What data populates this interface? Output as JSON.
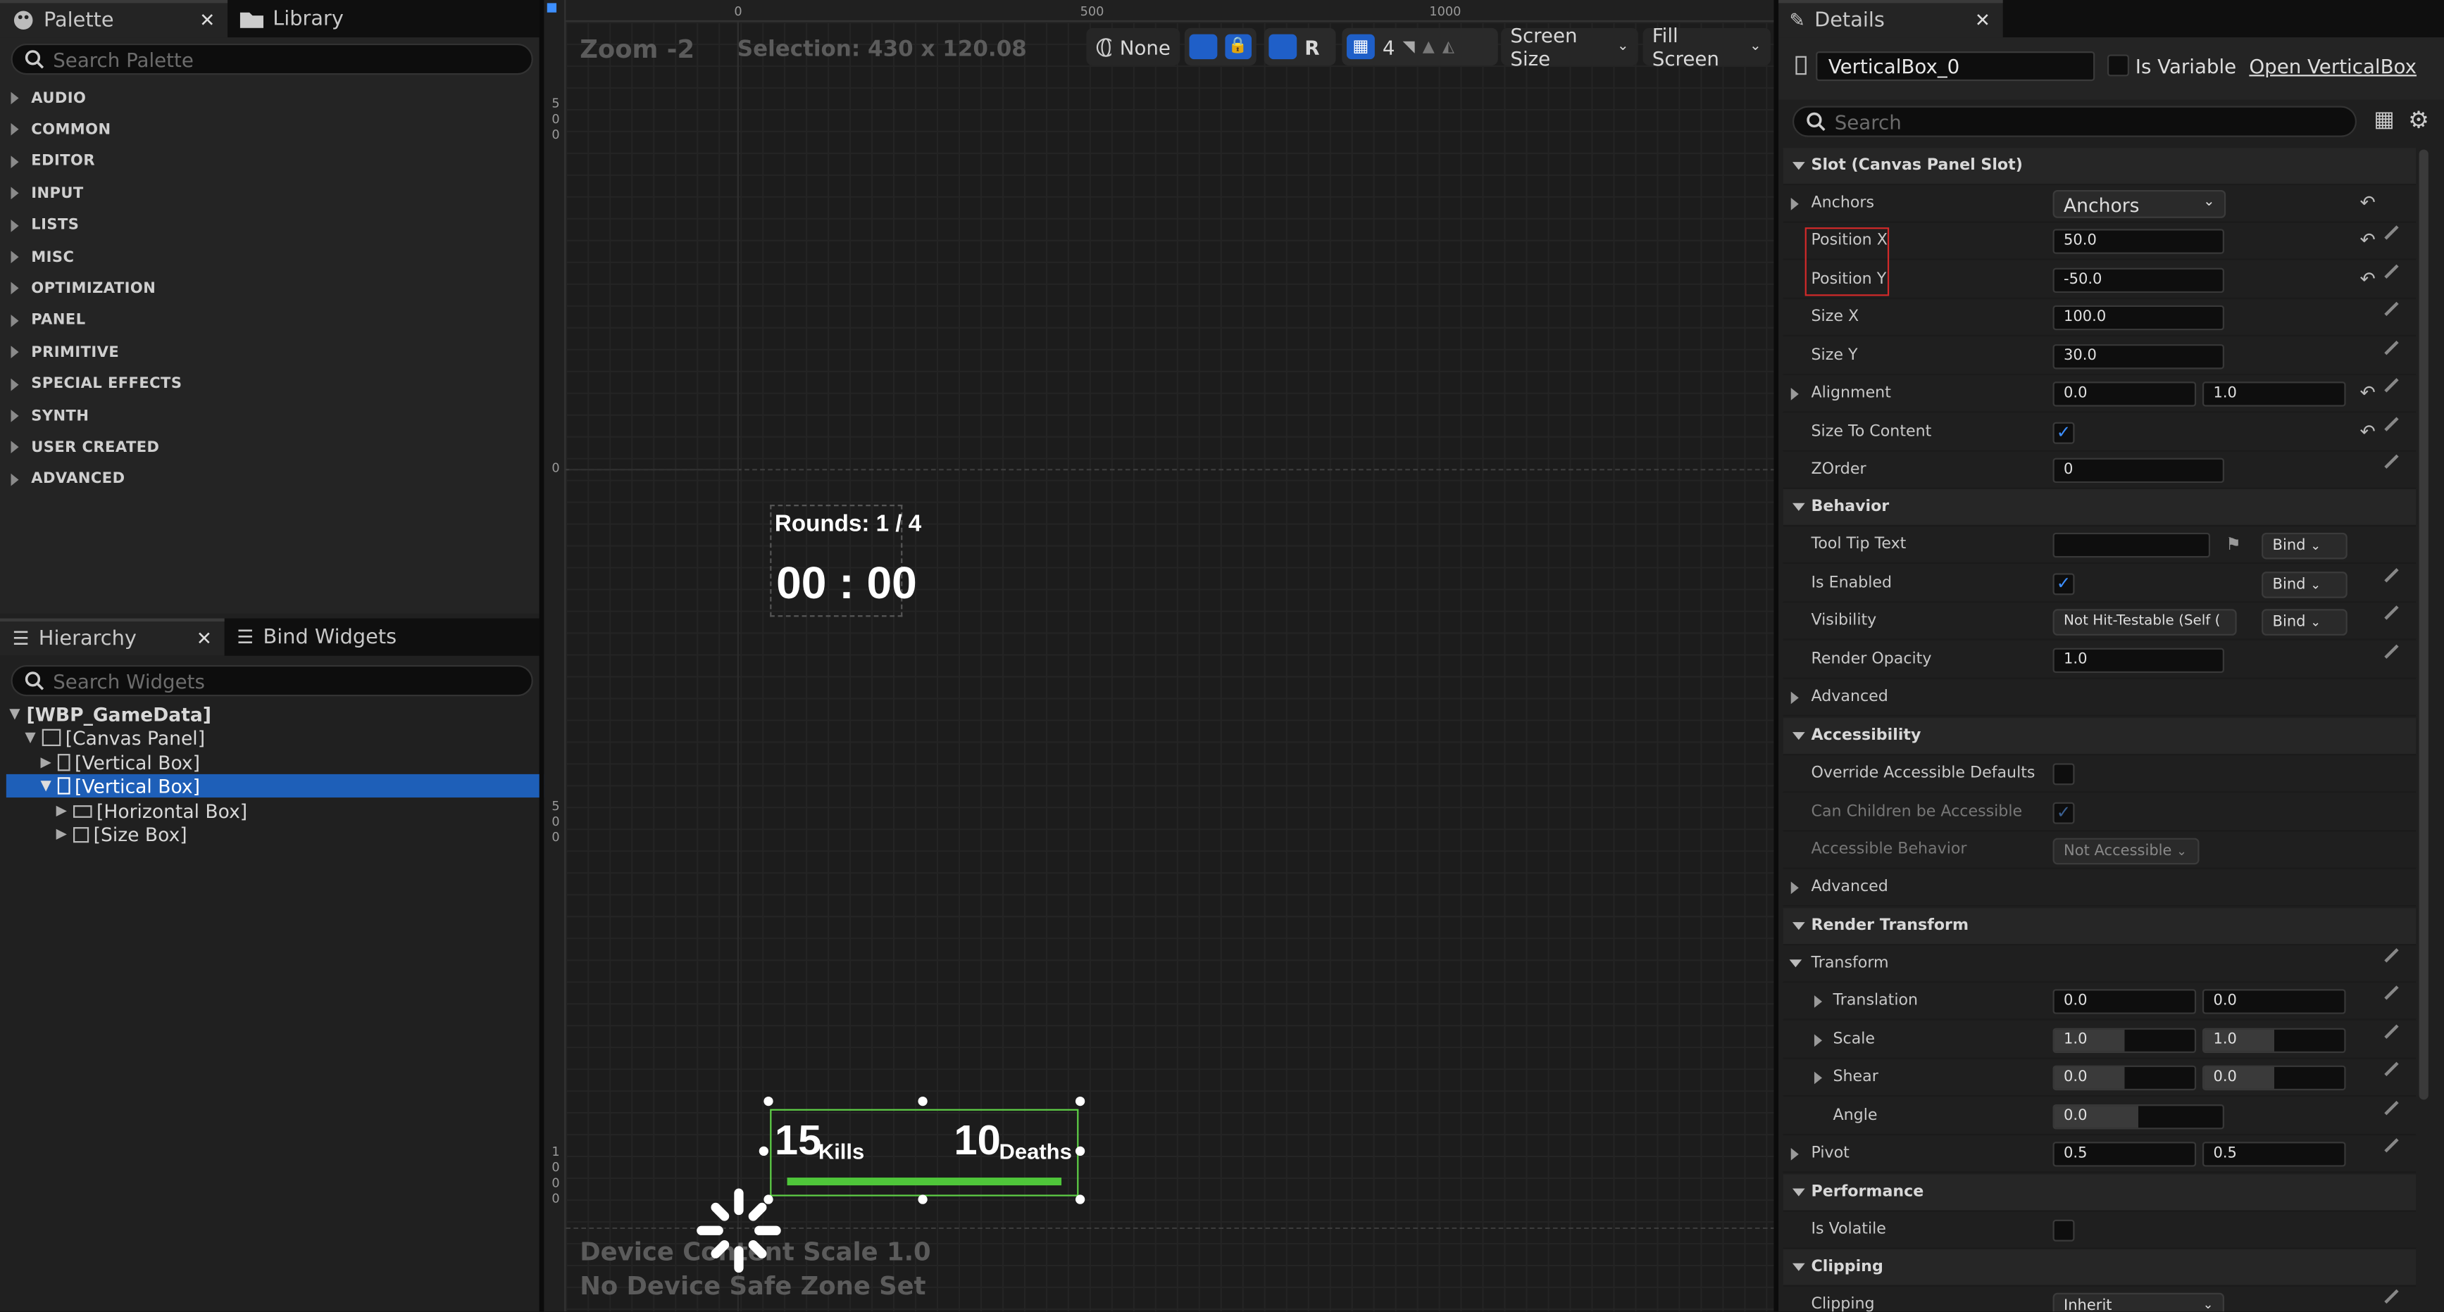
{
  "palette": {
    "tab_label": "Palette",
    "library_tab_label": "Library",
    "search_placeholder": "Search Palette",
    "categories": [
      "AUDIO",
      "COMMON",
      "EDITOR",
      "INPUT",
      "LISTS",
      "MISC",
      "OPTIMIZATION",
      "PANEL",
      "PRIMITIVE",
      "SPECIAL EFFECTS",
      "SYNTH",
      "USER CREATED",
      "ADVANCED"
    ]
  },
  "hierarchy": {
    "tab_label": "Hierarchy",
    "bind_tab_label": "Bind Widgets",
    "search_placeholder": "Search Widgets",
    "items": [
      "[WBP_GameData]",
      "[Canvas Panel]",
      "[Vertical Box]",
      "[Vertical Box]",
      "[Horizontal Box]",
      "[Size Box]"
    ]
  },
  "viewport": {
    "zoom_label": "Zoom -2",
    "selection_label": "Selection: 430 x 120.08",
    "ruler_top": [
      "0",
      "500",
      "1000"
    ],
    "ruler_left": [
      "500",
      "0",
      "500",
      "1000"
    ],
    "toolbar": {
      "none_label": "None",
      "r_label": "R",
      "grid_count": "4",
      "screen_size_label": "Screen Size",
      "fill_screen_label": "Fill Screen"
    },
    "rounds_label": "Rounds: 1 / 4",
    "timer_label": "00 : 00",
    "kills_value": "15",
    "kills_label": "Kills",
    "deaths_value": "10",
    "deaths_label": "Deaths",
    "device_content_label": "Device Content Scale 1.0",
    "safe_zone_label": "No Device Safe Zone Set"
  },
  "details": {
    "tab_label": "Details",
    "widget_name": "VerticalBox_0",
    "is_variable_label": "Is Variable",
    "open_label": "Open VerticalBox",
    "search_placeholder": "Search",
    "slot_section": "Slot (Canvas Panel Slot)",
    "anchors_label": "Anchors",
    "anchors_value": "Anchors",
    "position_x_label": "Position X",
    "position_x_value": "50.0",
    "position_y_label": "Position Y",
    "position_y_value": "-50.0",
    "size_x_label": "Size X",
    "size_x_value": "100.0",
    "size_y_label": "Size Y",
    "size_y_value": "30.0",
    "alignment_label": "Alignment",
    "alignment_x": "0.0",
    "alignment_y": "1.0",
    "size_to_content_label": "Size To Content",
    "zorder_label": "ZOrder",
    "zorder_value": "0",
    "behavior_section": "Behavior",
    "tooltip_label": "Tool Tip Text",
    "bind_label": "Bind",
    "is_enabled_label": "Is Enabled",
    "visibility_label": "Visibility",
    "visibility_value": "Not Hit-Testable (Self (",
    "render_opacity_label": "Render Opacity",
    "render_opacity_value": "1.0",
    "advanced_label": "Advanced",
    "accessibility_section": "Accessibility",
    "override_access_label": "Override Accessible Defaults",
    "children_access_label": "Can Children be Accessible",
    "access_behavior_label": "Accessible Behavior",
    "access_behavior_value": "Not Accessible",
    "advanced2_label": "Advanced",
    "render_transform_section": "Render Transform",
    "transform_label": "Transform",
    "translation_label": "Translation",
    "translation_x": "0.0",
    "translation_y": "0.0",
    "scale_label": "Scale",
    "scale_x": "1.0",
    "scale_y": "1.0",
    "shear_label": "Shear",
    "shear_x": "0.0",
    "shear_y": "0.0",
    "angle_label": "Angle",
    "angle_value": "0.0",
    "pivot_label": "Pivot",
    "pivot_x": "0.5",
    "pivot_y": "0.5",
    "performance_section": "Performance",
    "is_volatile_label": "Is Volatile",
    "clipping_section": "Clipping",
    "clipping_label": "Clipping",
    "clipping_value": "Inherit"
  },
  "colors": {
    "selection": "#1e5fb8",
    "selected_widget": "#5fd147",
    "highlight_box": "#d22a2a"
  }
}
